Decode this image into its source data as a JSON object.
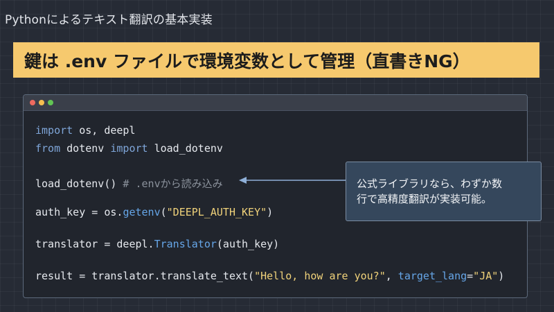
{
  "slide": {
    "title": "Pythonによるテキスト翻訳の基本実装",
    "headline": "鍵は .env ファイルで環境変数として管理（直書きNG）"
  },
  "code_window": {
    "lines": [
      {
        "tokens": [
          {
            "t": "import",
            "c": "kw"
          },
          {
            "t": " os, deepl",
            "c": "pl"
          }
        ]
      },
      {
        "tokens": [
          {
            "t": "from",
            "c": "kw"
          },
          {
            "t": " dotenv ",
            "c": "pl"
          },
          {
            "t": "import",
            "c": "kw"
          },
          {
            "t": " load_dotenv",
            "c": "pl"
          }
        ]
      },
      {
        "tokens": [
          {
            "t": "load_dotenv()",
            "c": "pl"
          },
          {
            "t": " # .envから読み込み",
            "c": "cm"
          }
        ]
      },
      {
        "tokens": [
          {
            "t": "auth_key = os.",
            "c": "pl"
          },
          {
            "t": "getenv",
            "c": "fn"
          },
          {
            "t": "(",
            "c": "pl"
          },
          {
            "t": "\"DEEPL_AUTH_KEY\"",
            "c": "str"
          },
          {
            "t": ")",
            "c": "pl"
          }
        ]
      },
      {
        "tokens": [
          {
            "t": "translator = deepl.",
            "c": "pl"
          },
          {
            "t": "Translator",
            "c": "fn"
          },
          {
            "t": "(auth_key)",
            "c": "pl"
          }
        ]
      },
      {
        "tokens": [
          {
            "t": "result = translator.translate_text(",
            "c": "pl"
          },
          {
            "t": "\"Hello, how are you?\"",
            "c": "str"
          },
          {
            "t": ", ",
            "c": "pl"
          },
          {
            "t": "target_lang",
            "c": "fn"
          },
          {
            "t": "=",
            "c": "pl"
          },
          {
            "t": "\"JA\"",
            "c": "str"
          },
          {
            "t": ")",
            "c": "pl"
          }
        ]
      }
    ]
  },
  "callout": {
    "text_line1": "公式ライブラリなら、わずか数",
    "text_line2": "行で高精度翻訳が実装可能。"
  },
  "colors": {
    "background": "#262b35",
    "headline_bg": "#f6c96e",
    "keyword": "#7fa6d9",
    "function": "#66a6e8",
    "string": "#f0d27a",
    "comment": "#8b929c",
    "callout_bg": "#35475c",
    "arrow": "#8fb0d8"
  }
}
